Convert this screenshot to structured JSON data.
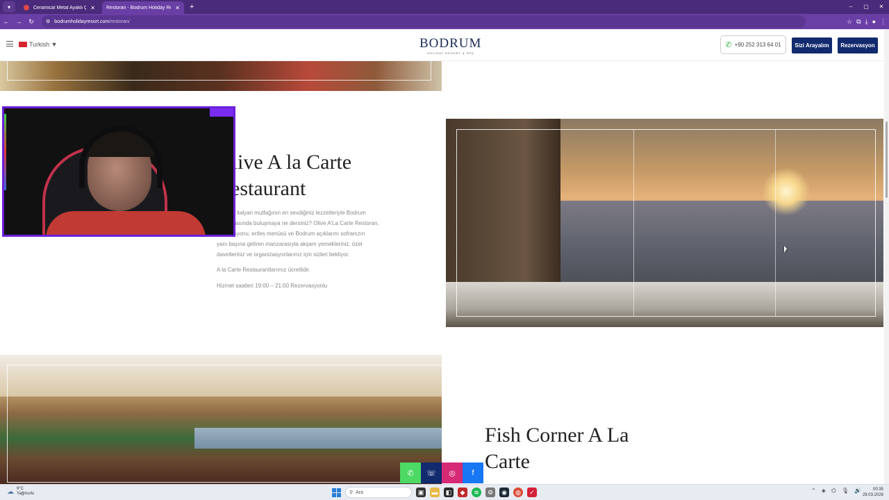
{
  "browser": {
    "tabs": [
      {
        "title": "Ceramical Metal Ayaklı Çalışma",
        "active": false
      },
      {
        "title": "Restoran - Bodrum Holiday Res",
        "active": true
      }
    ],
    "new_tab": "+",
    "url_domain": "bodrumholidayresort.com",
    "url_path": "/restoran/",
    "window_controls": {
      "minimize": "–",
      "maximize": "▢",
      "close": "✕"
    }
  },
  "header": {
    "language": "Turkish ▼",
    "logo_text": "BODRUM",
    "logo_sub": "HOLIDAY RESORT & SPA",
    "phone": "+90 252 313 64 01",
    "call_button": "Sizi Arayalım",
    "reserve_button": "Rezervasyon"
  },
  "olive": {
    "title_line1": "Olive A la Carte",
    "title_line2": "Restaurant",
    "paragraph_lines": [
      "Türk ve italyan mutfağının en sevdiğiniz lezzetleriyle Bodrum",
      "manzarasında buluşmaya ne dersiniz? Olive A'La Carte Restoran,",
      "dekorasyonu, enfes menüsü ve Bodrum açıklarını sofranızın",
      "yanı başına getiren manzarasıyla akşam yemekleriniz, özel",
      "davetleriniz ve organizasyonlarınız için sizleri bekliyor."
    ],
    "fee_note": "A la Carte Restaurantlarımız ücretlidir.",
    "hours": "Hizmet saatleri 19:00 – 21:00 Rezervasyonlu"
  },
  "fish": {
    "title_line1": "Fish Corner A La",
    "title_line2": "Carte"
  },
  "social": [
    {
      "icon": "whatsapp-icon",
      "glyph": "✆",
      "color": "#4cd964"
    },
    {
      "icon": "phone-icon",
      "glyph": "☏",
      "color": "#122a6e"
    },
    {
      "icon": "instagram-icon",
      "glyph": "◎",
      "color": "#d62976"
    },
    {
      "icon": "facebook-icon",
      "glyph": "f",
      "color": "#1877f2"
    }
  ],
  "taskbar": {
    "weather_temp": "9°C",
    "weather_text": "Yağmurlu",
    "search_placeholder": "Ara",
    "time": "00:35",
    "date": "29.03.2026"
  }
}
